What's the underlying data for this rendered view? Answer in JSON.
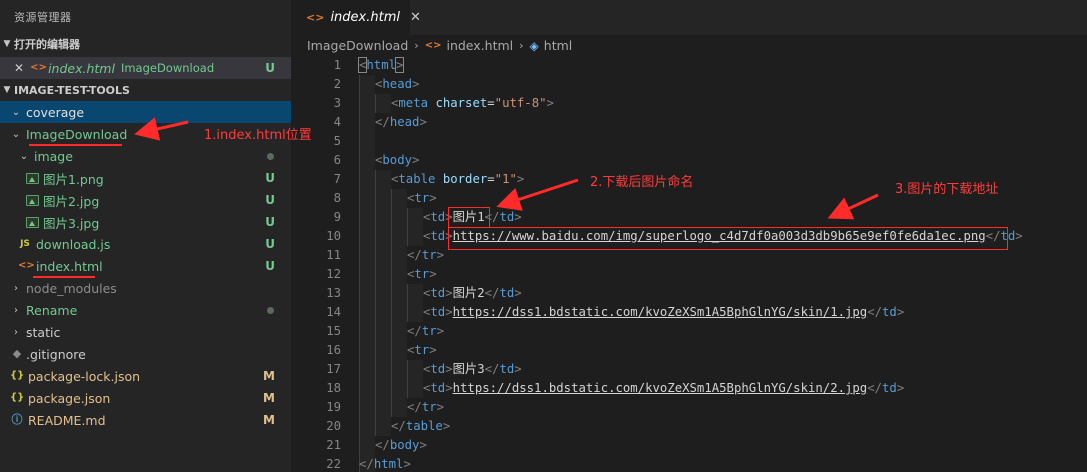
{
  "sidebar": {
    "title": "资源管理器",
    "open_editors": {
      "header": "打开的编辑器",
      "items": [
        {
          "close": "✕",
          "name": "index.html",
          "folder": "ImageDownload",
          "status": "U"
        }
      ]
    },
    "project": {
      "header": "IMAGE-TEST-TOOLS",
      "tree": [
        {
          "label": "coverage",
          "type": "folder",
          "expanded": true,
          "status": ""
        },
        {
          "label": "ImageDownload",
          "type": "folder",
          "expanded": true,
          "status": ""
        },
        {
          "label": "image",
          "type": "folder",
          "expanded": true,
          "status": "dot"
        },
        {
          "label": "图片1.png",
          "type": "image",
          "status": "U"
        },
        {
          "label": "图片2.jpg",
          "type": "image",
          "status": "U"
        },
        {
          "label": "图片3.jpg",
          "type": "image",
          "status": "U"
        },
        {
          "label": "download.js",
          "type": "js",
          "icon": "JS",
          "status": "U"
        },
        {
          "label": "index.html",
          "type": "html",
          "icon": "<>",
          "status": "U"
        },
        {
          "label": "node_modules",
          "type": "folder",
          "expanded": false,
          "status": ""
        },
        {
          "label": "Rename",
          "type": "folder",
          "expanded": false,
          "status": "dot"
        },
        {
          "label": "static",
          "type": "folder",
          "expanded": false,
          "status": ""
        },
        {
          "label": ".gitignore",
          "type": "git",
          "status": ""
        },
        {
          "label": "package-lock.json",
          "type": "json",
          "icon": "{}",
          "status": "M"
        },
        {
          "label": "package.json",
          "type": "json",
          "icon": "{}",
          "status": "M"
        },
        {
          "label": "README.md",
          "type": "info",
          "status": "M"
        }
      ]
    }
  },
  "editor": {
    "tab": {
      "icon": "<>",
      "name": "index.html",
      "close": "✕"
    },
    "breadcrumb": [
      "ImageDownload",
      "index.html",
      "html"
    ],
    "lines": [
      "1",
      "2",
      "3",
      "4",
      "5",
      "6",
      "7",
      "8",
      "9",
      "10",
      "11",
      "12",
      "13",
      "14",
      "15",
      "16",
      "17",
      "18",
      "19",
      "20",
      "21",
      "22"
    ],
    "code": {
      "l1": {
        "open": "<",
        "tag": "html",
        "close": ">"
      },
      "l2": {
        "open": "<",
        "tag": "head",
        "close": ">"
      },
      "l3": {
        "open": "<",
        "tag": "meta",
        "attr": "charset",
        "eq": "=",
        "val": "\"utf-8\"",
        "close": ">"
      },
      "l4": {
        "open": "</",
        "tag": "head",
        "close": ">"
      },
      "l6": {
        "open": "<",
        "tag": "body",
        "close": ">"
      },
      "l7": {
        "open": "<",
        "tag": "table",
        "attr": "border",
        "eq": "=",
        "val": "\"1\"",
        "close": ">"
      },
      "l8": {
        "open": "<",
        "tag": "tr",
        "close": ">"
      },
      "l9": {
        "td": "td",
        "text": "图片1"
      },
      "l10": {
        "td": "td",
        "text": "https://www.baidu.com/img/superlogo_c4d7df0a003d3db9b65e9ef0fe6da1ec.png"
      },
      "l11": {
        "open": "</",
        "tag": "tr",
        "close": ">"
      },
      "l12": {
        "open": "<",
        "tag": "tr",
        "close": ">"
      },
      "l13": {
        "td": "td",
        "text": "图片2"
      },
      "l14": {
        "td": "td",
        "text": "https://dss1.bdstatic.com/kvoZeXSm1A5BphGlnYG/skin/1.jpg"
      },
      "l15": {
        "open": "</",
        "tag": "tr",
        "close": ">"
      },
      "l16": {
        "open": "<",
        "tag": "tr",
        "close": ">"
      },
      "l17": {
        "td": "td",
        "text": "图片3"
      },
      "l18": {
        "td": "td",
        "text": "https://dss1.bdstatic.com/kvoZeXSm1A5BphGlnYG/skin/2.jpg"
      },
      "l19": {
        "open": "</",
        "tag": "tr",
        "close": ">"
      },
      "l20": {
        "open": "</",
        "tag": "table",
        "close": ">"
      },
      "l21": {
        "open": "</",
        "tag": "body",
        "close": ">"
      },
      "l22": {
        "open": "</",
        "tag": "html",
        "close": ">"
      }
    }
  },
  "annotations": {
    "a1": "1.index.html位置",
    "a2": "2.下载后图片命名",
    "a3": "3.图片的下载地址"
  },
  "colors": {
    "annotation": "#ff2a2a",
    "git_untracked": "#73c991",
    "git_modified": "#e2c08d",
    "selection": "#094771"
  }
}
